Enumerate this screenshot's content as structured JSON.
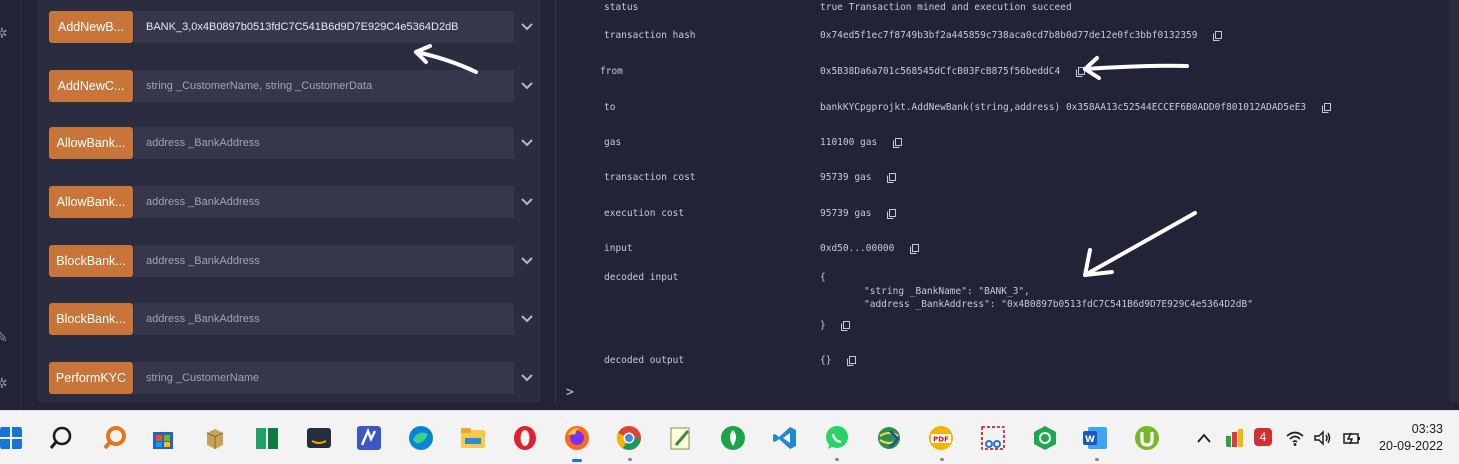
{
  "functions": [
    {
      "label": "AddNewB...",
      "value": "BANK_3,0x4B0897b0513fdC7C541B6d9D7E929C4e5364D2dB",
      "placeholder": ""
    },
    {
      "label": "AddNewC...",
      "value": "",
      "placeholder": "string _CustomerName, string _CustomerData"
    },
    {
      "label": "AllowBank...",
      "value": "",
      "placeholder": "address _BankAddress"
    },
    {
      "label": "AllowBank...",
      "value": "",
      "placeholder": "address _BankAddress"
    },
    {
      "label": "BlockBank...",
      "value": "",
      "placeholder": "address _BankAddress"
    },
    {
      "label": "BlockBank...",
      "value": "",
      "placeholder": "address _BankAddress"
    },
    {
      "label": "PerformKYC",
      "value": "",
      "placeholder": "string _CustomerName"
    }
  ],
  "tx": {
    "status_label": "status",
    "status_value": "true Transaction mined and execution succeed",
    "hash_label": "transaction hash",
    "hash_value": "0x74ed5f1ec7f8749b3bf2a445859c738aca0cd7b8b0d77de12e0fc3bbf0132359",
    "from_label": "from",
    "from_value": "0x5B38Da6a701c568545dCfcB03FcB875f56beddC4",
    "to_label": "to",
    "to_value": "bankKYCpgprojkt.AddNewBank(string,address) 0x358AA13c52544ECCEF6B0ADD0f801012ADAD5eE3",
    "gas_label": "gas",
    "gas_value": "110100 gas",
    "tcost_label": "transaction cost",
    "tcost_value": "95739 gas",
    "ecost_label": "execution cost",
    "ecost_value": "95739 gas",
    "input_label": "input",
    "input_value": "0xd50...00000",
    "decoded_input_label": "decoded input",
    "decoded_open": "{",
    "decoded_line1": "\"string _BankName\": \"BANK_3\",",
    "decoded_line2": "\"address _BankAddress\": \"0x4B0897b0513fdC7C541B6d9D7E929C4e5364D2dB\"",
    "decoded_close": "}",
    "decoded_output_label": "decoded output",
    "decoded_output_value": "{}"
  },
  "prompt": ">",
  "taskbar": {
    "time": "03:33",
    "date": "20-09-2022",
    "badge": "4",
    "apps": [
      "windows-start",
      "search",
      "magnifier-app",
      "store",
      "package-app",
      "green-blocks-app",
      "amazon-app",
      "editor-app",
      "edge",
      "file-explorer",
      "opera",
      "firefox",
      "chrome",
      "notepad-plus",
      "green-circle-app",
      "vscode",
      "whatsapp",
      "globe-app",
      "pdf-app",
      "snipping-app",
      "hexagon-app",
      "word",
      "utorrent"
    ]
  },
  "colors": {
    "accent": "#c97539",
    "background": "#222336",
    "panel": "#2a2c3f"
  }
}
